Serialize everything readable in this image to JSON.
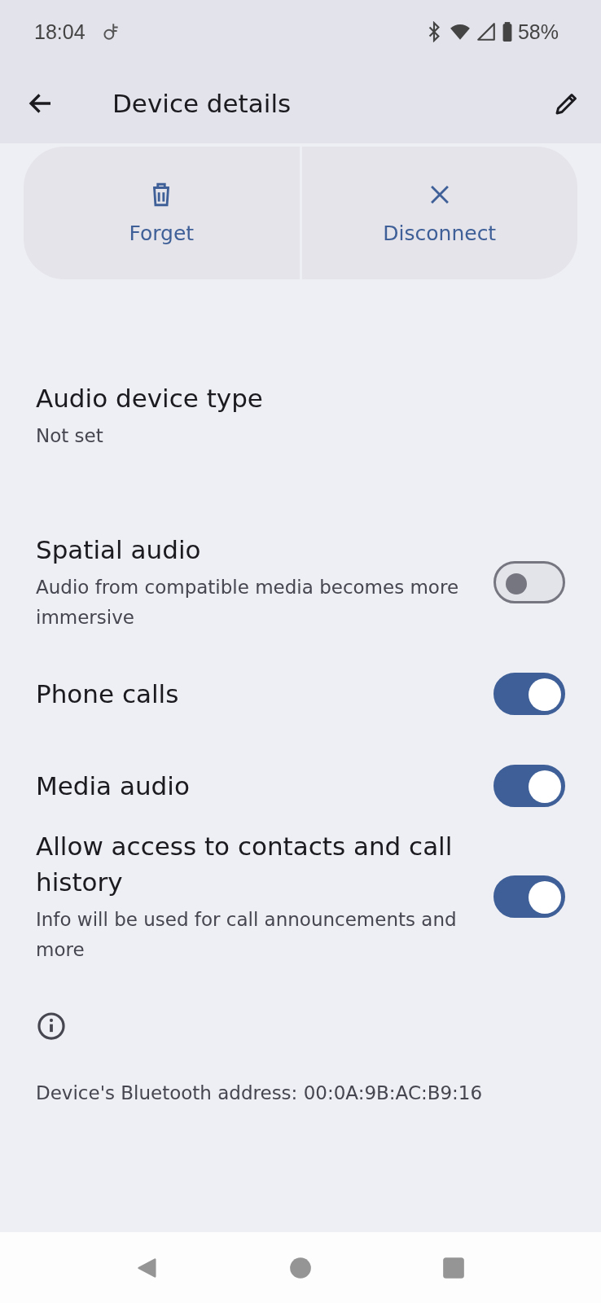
{
  "status_bar": {
    "time": "18:04",
    "battery": "58%"
  },
  "app_bar": {
    "title": "Device details"
  },
  "actions": [
    {
      "label": "Forget",
      "kind": "delete"
    },
    {
      "label": "Disconnect",
      "kind": "close"
    }
  ],
  "settings": [
    {
      "kind": "text",
      "title": "Audio device type",
      "summary": "Not set"
    },
    {
      "kind": "switch",
      "title": "Spatial audio",
      "summary": "Audio from compatible media becomes more immersive",
      "on": false
    },
    {
      "kind": "switch",
      "title": "Phone calls",
      "on": true
    },
    {
      "kind": "switch",
      "title": "Media audio",
      "on": true
    },
    {
      "kind": "switch",
      "title": "Allow access to contacts and call history",
      "summary": "Info will be used for call announcements and more",
      "on": true
    }
  ],
  "footer": {
    "address": "Device's Bluetooth address: 00:0A:9B:AC:B9:16"
  }
}
